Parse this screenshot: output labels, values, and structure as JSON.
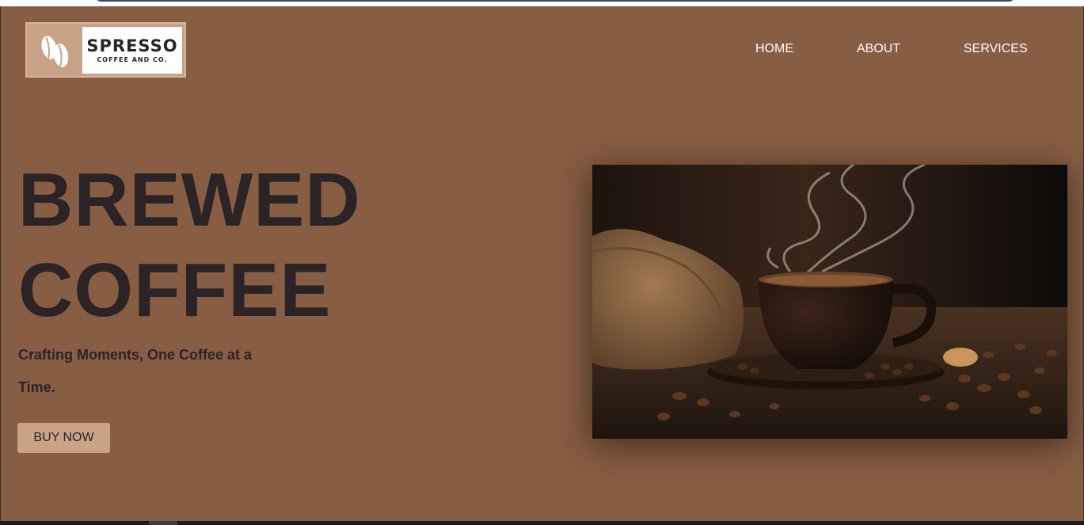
{
  "logo": {
    "brand": "SPRESSO",
    "tagline": "COFFEE AND CO.",
    "icon": "coffee-beans-icon"
  },
  "nav": {
    "items": [
      {
        "label": "HOME"
      },
      {
        "label": "ABOUT"
      },
      {
        "label": "SERVICES"
      }
    ]
  },
  "hero": {
    "title_line1": "BREWED",
    "title_line2": "COFFEE",
    "tagline": "Crafting Moments, One Coffee at a Time.",
    "cta_label": "BUY NOW",
    "image": "coffee-cup-photo"
  },
  "colors": {
    "background": "#875d43",
    "title": "#2b2326",
    "button": "#caa387"
  }
}
